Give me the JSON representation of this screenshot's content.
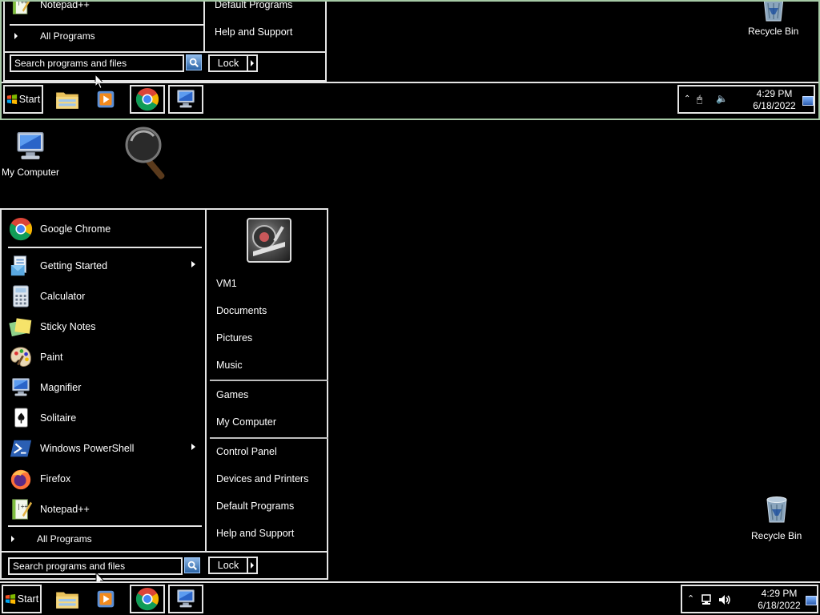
{
  "desktop": {
    "my_computer_label": "My Computer",
    "recycle_bin_label": "Recycle Bin"
  },
  "start_menu": {
    "programs": [
      {
        "label": "Google Chrome",
        "icon": "chrome-icon",
        "submenu": false
      },
      {
        "label": "Getting Started",
        "icon": "getting-started-icon",
        "submenu": true
      },
      {
        "label": "Calculator",
        "icon": "calculator-icon",
        "submenu": false
      },
      {
        "label": "Sticky Notes",
        "icon": "sticky-notes-icon",
        "submenu": false
      },
      {
        "label": "Paint",
        "icon": "paint-icon",
        "submenu": false
      },
      {
        "label": "Magnifier",
        "icon": "magnifier-icon",
        "submenu": false
      },
      {
        "label": "Solitaire",
        "icon": "solitaire-icon",
        "submenu": false
      },
      {
        "label": "Windows PowerShell",
        "icon": "powershell-icon",
        "submenu": true
      },
      {
        "label": "Firefox",
        "icon": "firefox-icon",
        "submenu": false
      },
      {
        "label": "Notepad++",
        "icon": "notepadpp-icon",
        "submenu": false
      }
    ],
    "all_programs_label": "All Programs",
    "search_placeholder": "Search programs and files",
    "lock_label": "Lock",
    "right_links": {
      "user": "VM1",
      "documents": "Documents",
      "pictures": "Pictures",
      "music": "Music",
      "games": "Games",
      "my_computer": "My Computer",
      "control_panel": "Control Panel",
      "devices_printers": "Devices and Printers",
      "default_programs": "Default Programs",
      "help_support": "Help and Support"
    }
  },
  "taskbar": {
    "start_label": "Start",
    "pinned": [
      "file-explorer-icon",
      "media-player-icon",
      "chrome-icon",
      "my-computer-icon"
    ],
    "time": "4:29 PM",
    "date": "6/18/2022"
  },
  "colors": {
    "background": "#000000",
    "border": "#e5e5e5",
    "lens_border": "#a6c9a6"
  }
}
